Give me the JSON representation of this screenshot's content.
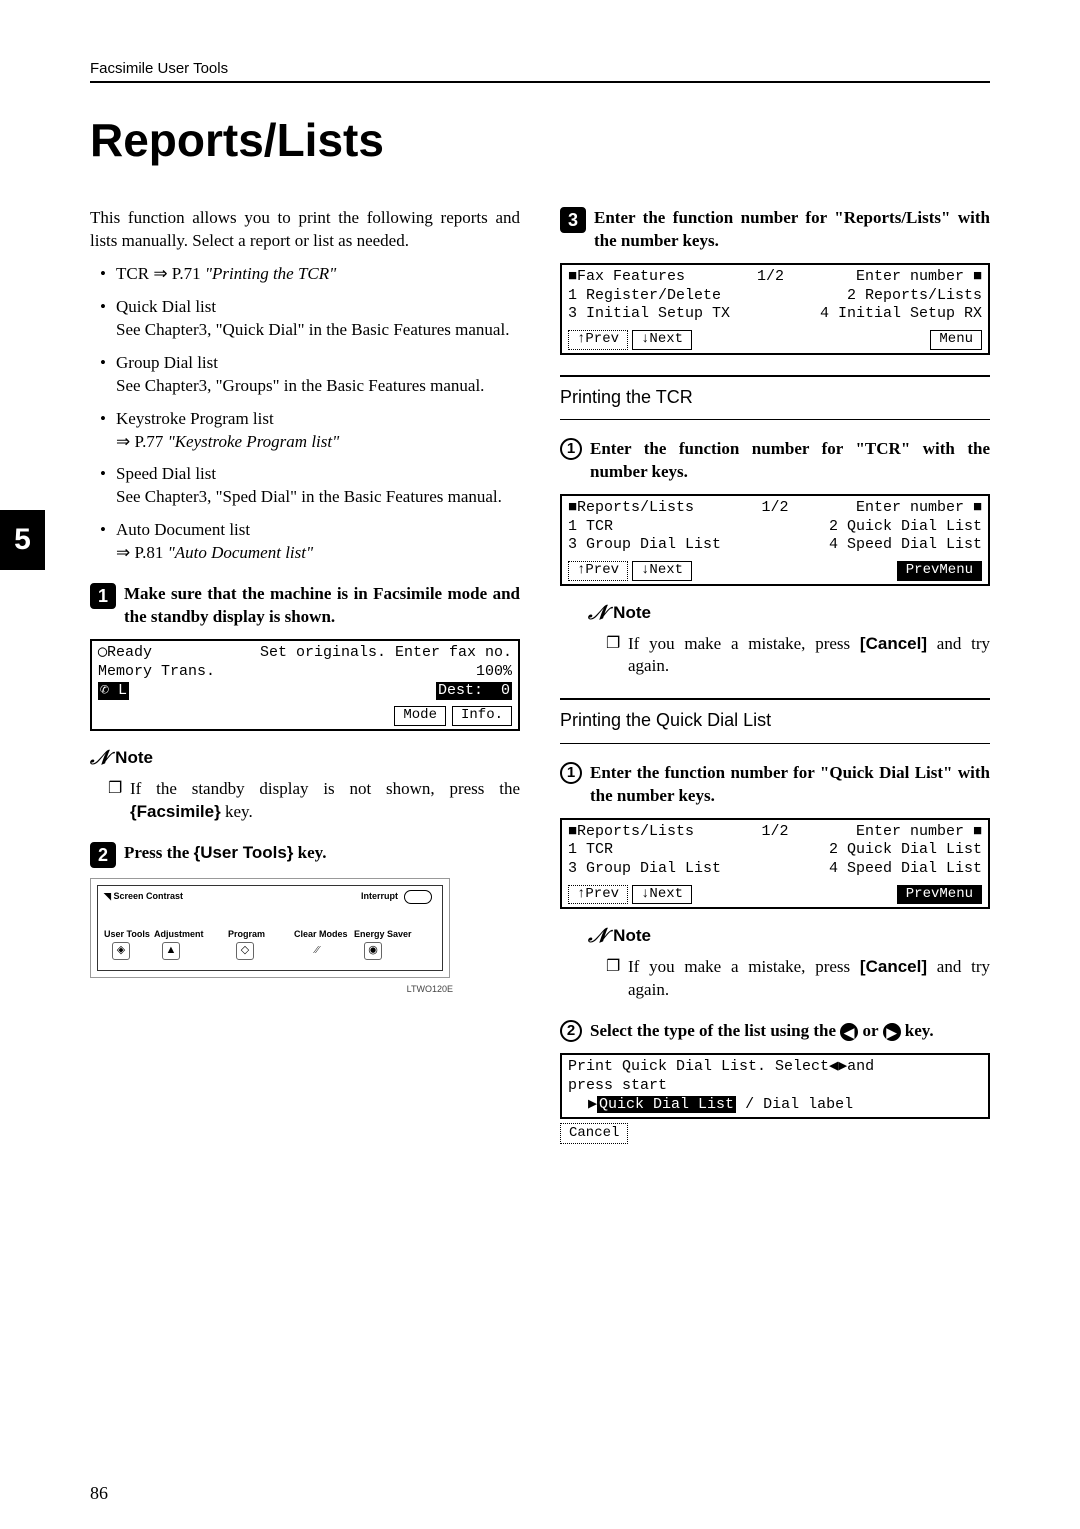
{
  "header": "Facsimile User Tools",
  "title": "Reports/Lists",
  "page_num": "86",
  "side_tab": "5",
  "left": {
    "intro": "This function allows you to print the following reports and lists manually. Select a report or list as needed.",
    "bullets": [
      {
        "head": "TCR",
        "ref": "⇒ P.71",
        "ref_italic": "\"Printing the TCR\""
      },
      {
        "head": "Quick Dial list",
        "sub": "See Chapter3, \"Quick Dial\" in the Basic Features manual."
      },
      {
        "head": "Group Dial list",
        "sub": "See Chapter3, \"Groups\" in the Basic Features manual."
      },
      {
        "head": "Keystroke Program list",
        "ref": "⇒ P.77",
        "ref_italic": "\"Keystroke Program list\""
      },
      {
        "head": "Speed Dial list",
        "sub": "See Chapter3, \"Sped Dial\" in the Basic Features manual."
      },
      {
        "head": "Auto Document list",
        "ref": "⇒ P.81",
        "ref_italic": "\"Auto Document list\""
      }
    ],
    "step1": "Make sure that the machine is in Facsimile mode and the standby display is shown.",
    "lcd1": {
      "r1a": "◯Ready",
      "r1b": "Set originals. Enter fax no.",
      "r2a": "Memory Trans.",
      "r2b": "100%",
      "r3a": "✆ L",
      "r3b": "Dest:  0",
      "b1": "Mode",
      "b2": "Info."
    },
    "note_label": "Note",
    "note1": "If the standby display is not shown, press the ",
    "note1_key": "Facsimile",
    "note1_end": " key.",
    "step2_a": "Press the ",
    "step2_key": "User Tools",
    "step2_b": " key.",
    "panel": {
      "contrast": "Screen Contrast",
      "interrupt": "Interrupt",
      "ut": "User Tools",
      "adj": "Adjustment",
      "prog": "Program",
      "cm": "Clear Modes",
      "es": "Energy Saver",
      "caption": "LTWO120E"
    }
  },
  "right": {
    "step3": "Enter the function number for \"Reports/Lists\" with the number keys.",
    "lcd3": {
      "title": "■Fax Features",
      "page": "1/2",
      "hint": "Enter number ■",
      "i1": "1 Register/Delete",
      "i2": "2 Reports/Lists",
      "i3": "3 Initial Setup TX",
      "i4": "4 Initial Setup RX",
      "b1": "↑Prev",
      "b2": "↓Next",
      "menu": "Menu"
    },
    "sec1": "Printing the TCR",
    "sec1_step": "Enter the function number for \"TCR\" with the number keys.",
    "lcd_rl": {
      "title": "■Reports/Lists",
      "page": "1/2",
      "hint": "Enter number ■",
      "i1": "1 TCR",
      "i2": "2 Quick Dial List",
      "i3": "3 Group Dial List",
      "i4": "4 Speed Dial List",
      "b1": "↑Prev",
      "b2": "↓Next",
      "menu": "PrevMenu"
    },
    "note2": "If you make a mistake, press ",
    "note2_key": "[Cancel]",
    "note2_end": " and try again.",
    "sec2": "Printing the Quick Dial List",
    "sec2_step": "Enter the function number for \"Quick Dial List\" with the number keys.",
    "sec2_step2": "Select the type of the list using the ",
    "sec2_step2_end": " key.",
    "or": " or ",
    "lcd_qd": {
      "r1": "Print Quick Dial List. Select◀▶and",
      "r2": "press start",
      "opt1": "Quick Dial List",
      "sep": " / ",
      "opt2": "Dial label",
      "cancel": "Cancel"
    }
  }
}
